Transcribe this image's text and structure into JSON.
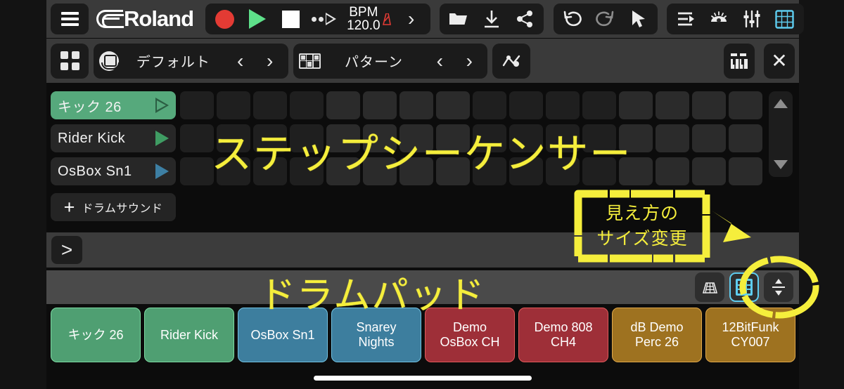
{
  "app": {
    "brand": "Roland",
    "platform_home_indicator": true
  },
  "toolbar_top": {
    "menu_label": "menu",
    "transport": {
      "record_label": "Record",
      "play_label": "Play",
      "stop_label": "Stop",
      "step_play_label": "Step Play",
      "bpm_label": "BPM",
      "bpm_value": "120.0",
      "metronome_label": "Metronome",
      "expand_label": "Expand"
    },
    "file_group": {
      "open_label": "Open",
      "save_label": "Save",
      "share_label": "Share"
    },
    "edit_group": {
      "undo_label": "Undo",
      "redo_label": "Redo",
      "select_label": "Select"
    },
    "view_group": {
      "list_label": "List",
      "eye_label": "Visibility",
      "mixer_label": "Mixer",
      "grid_label": "Grid"
    }
  },
  "toolbar_second": {
    "apps_label": "Apps",
    "kit": {
      "icon": "drum-kit-icon",
      "name": "デフォルト",
      "prev_label": "<",
      "next_label": ">"
    },
    "pattern": {
      "icon": "pattern-grid-icon",
      "name": "パターン",
      "prev_label": "<",
      "next_label": ">"
    },
    "automation_label": "Automation",
    "keyboard_label": "Keyboard",
    "close_label": "✕"
  },
  "sequencer": {
    "tracks": [
      {
        "name": "キック 26",
        "active": true,
        "play_color": "outline"
      },
      {
        "name": "Rider Kick",
        "active": false,
        "play_color": "green"
      },
      {
        "name": "OsBox Sn1",
        "active": false,
        "play_color": "blue"
      }
    ],
    "add_sound": {
      "plus": "+",
      "label": "ドラムサウンド"
    },
    "step_count": 16,
    "scroll": {
      "up_label": "Scroll up",
      "down_label": "Scroll down"
    },
    "expander_label": ">"
  },
  "pad_toolbar": {
    "perspective_label": "Perspective view",
    "grid_label": "Grid view",
    "grid_active": true,
    "resize_label": "Resize",
    "accent_color": "#5ecdf0"
  },
  "pads": [
    {
      "label": "キック 26",
      "color": "green"
    },
    {
      "label": "Rider Kick",
      "color": "green"
    },
    {
      "label": "OsBox Sn1",
      "color": "blue"
    },
    {
      "label": "Snarey\nNights",
      "color": "blue"
    },
    {
      "label": "Demo\nOsBox CH",
      "color": "red"
    },
    {
      "label": "Demo 808\nCH4",
      "color": "red"
    },
    {
      "label": "dB Demo\nPerc 26",
      "color": "amber"
    },
    {
      "label": "12BitFunk\nCY007",
      "color": "amber"
    }
  ],
  "annotations": {
    "color": "#f5ee3c",
    "sequencer_label": "ステップシーケンサー",
    "pad_label": "ドラムパッド",
    "callout_line1": "見え方の",
    "callout_line2": "サイズ変更"
  }
}
